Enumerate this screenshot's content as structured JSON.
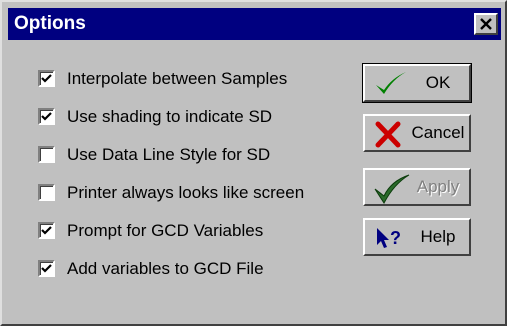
{
  "window": {
    "title": "Options"
  },
  "options": [
    {
      "label": "Interpolate between Samples",
      "checked": true
    },
    {
      "label": "Use shading to indicate SD",
      "checked": true
    },
    {
      "label": "Use Data Line Style for SD",
      "checked": false
    },
    {
      "label": "Printer always looks like screen",
      "checked": false
    },
    {
      "label": "Prompt for GCD Variables",
      "checked": true
    },
    {
      "label": "Add variables to GCD File",
      "checked": true
    }
  ],
  "buttons": {
    "ok": {
      "label": "OK",
      "icon": "checkmark-icon",
      "color": "#008000"
    },
    "cancel": {
      "label": "Cancel",
      "icon": "red-x-icon",
      "color": "#cc0000"
    },
    "apply": {
      "label": "Apply",
      "icon": "checkmark-icon",
      "enabled": false
    },
    "help": {
      "label": "Help",
      "icon": "help-pointer-icon",
      "color": "#000080"
    }
  }
}
